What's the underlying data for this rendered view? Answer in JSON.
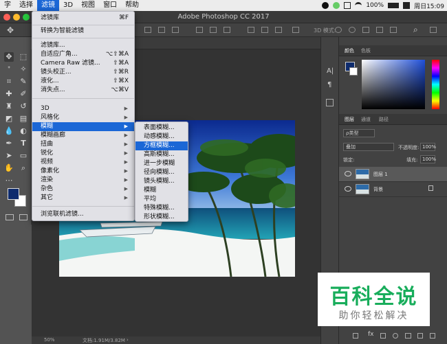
{
  "menubar": {
    "items": [
      "字",
      "选择",
      "滤镜",
      "3D",
      "视图",
      "窗口",
      "帮助"
    ],
    "active_index": 2,
    "status": {
      "battery": "100%",
      "time": "周日15:09"
    }
  },
  "window": {
    "title": "Adobe Photoshop CC 2017"
  },
  "options_bar": {
    "label_3d": "3D 模式:"
  },
  "filter_menu": {
    "top_items": [
      {
        "label": "滤镜库",
        "shortcut": "⌘F"
      },
      {
        "label": "转换为智能滤镜",
        "shortcut": ""
      }
    ],
    "mid_items": [
      {
        "label": "滤镜库...",
        "shortcut": ""
      },
      {
        "label": "自适应广角...",
        "shortcut": "⌥⇧⌘A"
      },
      {
        "label": "Camera Raw 滤镜...",
        "shortcut": "⇧⌘A"
      },
      {
        "label": "镜头校正...",
        "shortcut": "⇧⌘R"
      },
      {
        "label": "液化...",
        "shortcut": "⇧⌘X"
      },
      {
        "label": "消失点...",
        "shortcut": "⌥⌘V"
      }
    ],
    "sub_items": [
      "3D",
      "风格化",
      "模糊",
      "模糊画廊",
      "扭曲",
      "锐化",
      "视频",
      "像素化",
      "渲染",
      "杂色",
      "其它"
    ],
    "highlighted_sub": 2,
    "bottom_item": "浏览联机滤镜..."
  },
  "blur_menu": {
    "items": [
      "表面模糊...",
      "动感模糊...",
      "方框模糊...",
      "高斯模糊...",
      "进一步模糊",
      "径向模糊...",
      "镜头模糊...",
      "模糊",
      "平均",
      "特殊模糊...",
      "形状模糊..."
    ],
    "highlighted": 2
  },
  "panels": {
    "color_tabs": [
      "颜色",
      "色板"
    ],
    "layers_tabs": [
      "图层",
      "通道",
      "路径"
    ],
    "kind_label": "ρ类型",
    "blend_mode": "叠加",
    "opacity_label": "不透明度:",
    "opacity_value": "100%",
    "lock_label": "锁定:",
    "fill_label": "填充:",
    "fill_value": "100%",
    "layers": [
      {
        "name": "图层 1",
        "selected": true
      },
      {
        "name": "背景",
        "selected": false
      }
    ]
  },
  "status_bar": {
    "zoom": "50%",
    "doc": "文档:1.91M/3.82M"
  },
  "watermark": {
    "title": "百科全说",
    "subtitle": "助你轻松解决"
  },
  "colors": {
    "fg": "#0e2b6d",
    "bg": "#ffffff",
    "accent": "#1b67d6",
    "wm_green": "#18ad5b"
  }
}
